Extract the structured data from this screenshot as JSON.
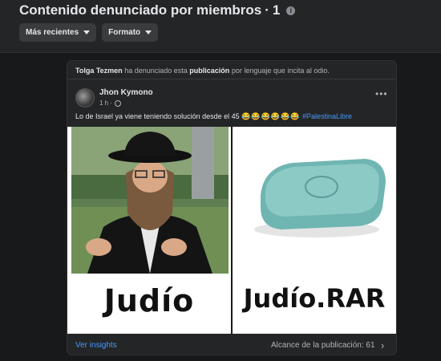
{
  "header": {
    "title": "Contenido denunciado por miembros",
    "separator": "·",
    "count": "1",
    "filters": [
      {
        "label": "Más recientes"
      },
      {
        "label": "Formato"
      }
    ]
  },
  "post": {
    "report": {
      "reporter": "Tolga Tezmen",
      "text_before": "ha denunciado esta",
      "object": "publicación",
      "text_after": "por lenguaje que incita al odio."
    },
    "author": "Jhon Kymono",
    "time": "1 h ·",
    "text": "Lo de Israel ya viene teniendo solución desde el 45",
    "emojis": "😂😂😂😂😂😂",
    "hashtag": "#PalestinaLibre",
    "images": [
      {
        "caption": "Judío"
      },
      {
        "caption": "Judío.RAR"
      }
    ],
    "footer": {
      "insights_label": "Ver insights",
      "reach_label": "Alcance de la publicación: 61"
    }
  },
  "colors": {
    "background": "#18191a",
    "card": "#242526",
    "link": "#4599ff",
    "muted_text": "#b0b3b8"
  }
}
